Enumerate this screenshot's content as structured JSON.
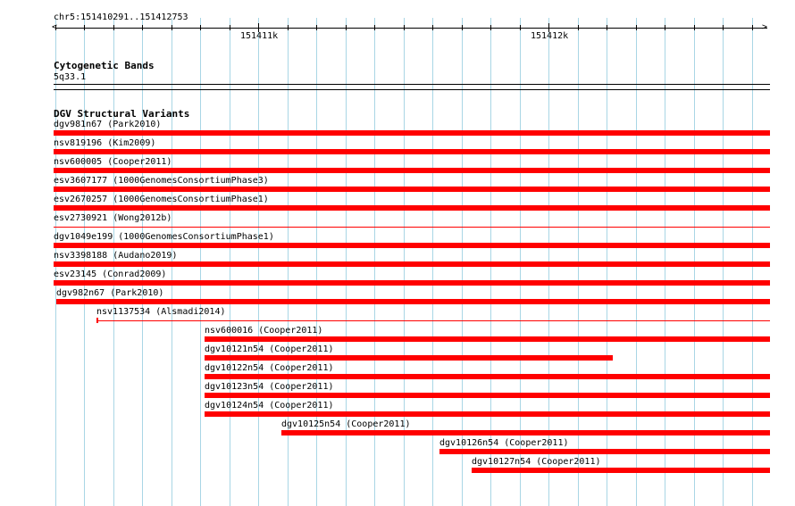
{
  "colors": {
    "gridline": "#a9d6e5",
    "feature": "#ff0000",
    "ruler": "#000000"
  },
  "location_label": "chr5:151410291..151412753",
  "ruler_labels": [
    "151411k",
    "151412k"
  ],
  "cytoband": {
    "title": "Cytogenetic Bands",
    "band": "5q33.1"
  },
  "dgv": {
    "title": "DGV Structural Variants",
    "features": [
      {
        "label": "dgv981n67 (Park2010)"
      },
      {
        "label": "nsv819196 (Kim2009)"
      },
      {
        "label": "nsv600005 (Cooper2011)"
      },
      {
        "label": "esv3607177 (1000GenomesConsortiumPhase3)"
      },
      {
        "label": "esv2670257 (1000GenomesConsortiumPhase1)"
      },
      {
        "label": "esv2730921 (Wong2012b)"
      },
      {
        "label": "dgv1049e199 (1000GenomesConsortiumPhase1)"
      },
      {
        "label": "nsv3398188 (Audano2019)"
      },
      {
        "label": "esv23145 (Conrad2009)"
      },
      {
        "label": "dgv982n67 (Park2010)"
      },
      {
        "label": "nsv1137534 (Alsmadi2014)"
      },
      {
        "label": "nsv600016 (Cooper2011)"
      },
      {
        "label": "dgv10121n54 (Cooper2011)"
      },
      {
        "label": "dgv10122n54 (Cooper2011)"
      },
      {
        "label": "dgv10123n54 (Cooper2011)"
      },
      {
        "label": "dgv10124n54 (Cooper2011)"
      },
      {
        "label": "dgv10125n54 (Cooper2011)"
      },
      {
        "label": "dgv10126n54 (Cooper2011)"
      },
      {
        "label": "dgv10127n54 (Cooper2011)"
      }
    ]
  }
}
